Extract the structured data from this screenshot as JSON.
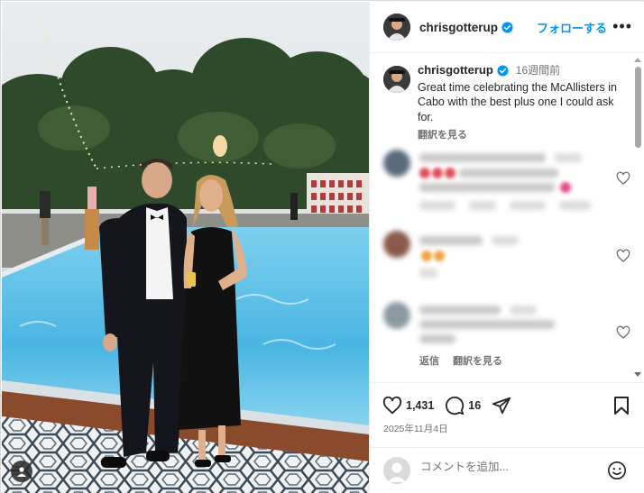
{
  "post": {
    "username": "chrisgotterup",
    "verified": true,
    "follow_label": "フォローする",
    "more_icon": "more-horizontal-icon",
    "caption": {
      "username": "chrisgotterup",
      "time_ago": "16週間前",
      "text": "Great time celebrating the McAllisters in Cabo with the best plus one I could ask for.",
      "translate_label": "翻訳を見る"
    },
    "comments": [
      {
        "blurred": true,
        "has_like_icon": true
      },
      {
        "blurred": true,
        "has_like_icon": true
      },
      {
        "blurred": true,
        "has_like_icon": true,
        "reply_label": "返信",
        "translate_label": "翻訳を見る"
      }
    ],
    "stats": {
      "likes": "1,431",
      "comments": "16",
      "date": "2025年11月4日"
    },
    "icons": {
      "like": "heart-icon",
      "comment": "comment-icon",
      "share": "share-icon",
      "save": "bookmark-icon",
      "emoji": "emoji-icon",
      "user_tag": "user-tag-icon"
    },
    "add_comment": {
      "placeholder": "コメントを追加..."
    }
  },
  "colors": {
    "accent": "#0095f6",
    "verified": "#0095f6",
    "secondary_text": "#737373",
    "border": "#efefef"
  }
}
